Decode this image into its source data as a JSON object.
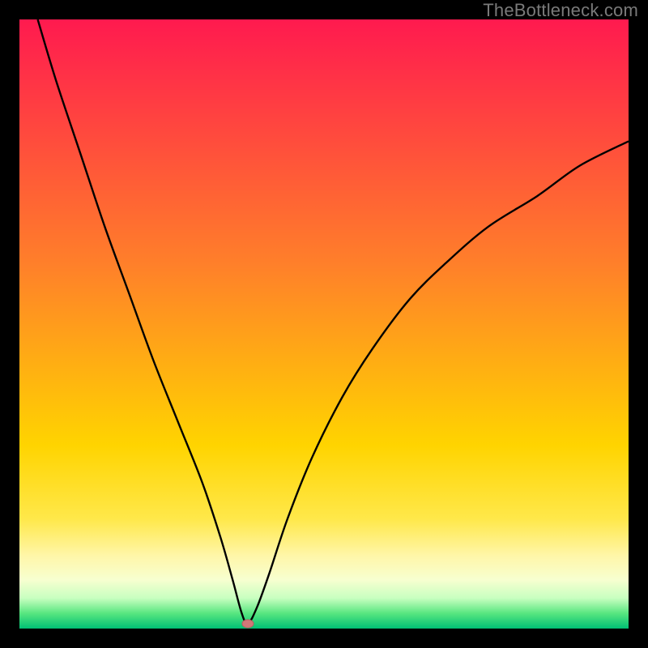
{
  "watermark": "TheBottleneck.com",
  "colors": {
    "frame": "#000000",
    "curve": "#000000",
    "marker_fill": "#d07878",
    "marker_stroke": "#b86060",
    "gradient_stops": [
      {
        "offset": 0.0,
        "color": "#ff1a4f"
      },
      {
        "offset": 0.4,
        "color": "#ff7f2a"
      },
      {
        "offset": 0.7,
        "color": "#ffd400"
      },
      {
        "offset": 0.82,
        "color": "#ffe84a"
      },
      {
        "offset": 0.88,
        "color": "#fff6a8"
      },
      {
        "offset": 0.92,
        "color": "#f7ffd0"
      },
      {
        "offset": 0.95,
        "color": "#c8ffc0"
      },
      {
        "offset": 0.975,
        "color": "#58e680"
      },
      {
        "offset": 1.0,
        "color": "#00c074"
      }
    ]
  },
  "chart_data": {
    "type": "line",
    "title": "",
    "xlabel": "",
    "ylabel": "",
    "xlim": [
      0,
      100
    ],
    "ylim": [
      0,
      100
    ],
    "legend": false,
    "grid": false,
    "notes": "Bottleneck-style V curve. y ≈ 0 at x ≈ 37 (minimum, marked by dot). Left branch rises steeply to y=100 at x≈3. Right branch rises with decreasing slope toward y≈80 at x=100.",
    "series": [
      {
        "name": "bottleneck-curve",
        "x": [
          3,
          6,
          10,
          14,
          18,
          22,
          26,
          30,
          33,
          35,
          36.5,
          37.5,
          39,
          41,
          44,
          48,
          53,
          58,
          64,
          70,
          77,
          85,
          92,
          100
        ],
        "values": [
          100,
          90,
          78,
          66,
          55,
          44,
          34,
          24,
          15,
          8,
          2.5,
          0.8,
          3.5,
          9,
          18,
          28,
          38,
          46,
          54,
          60,
          66,
          71,
          76,
          80
        ]
      }
    ],
    "marker": {
      "x": 37.5,
      "y": 0.8
    }
  }
}
